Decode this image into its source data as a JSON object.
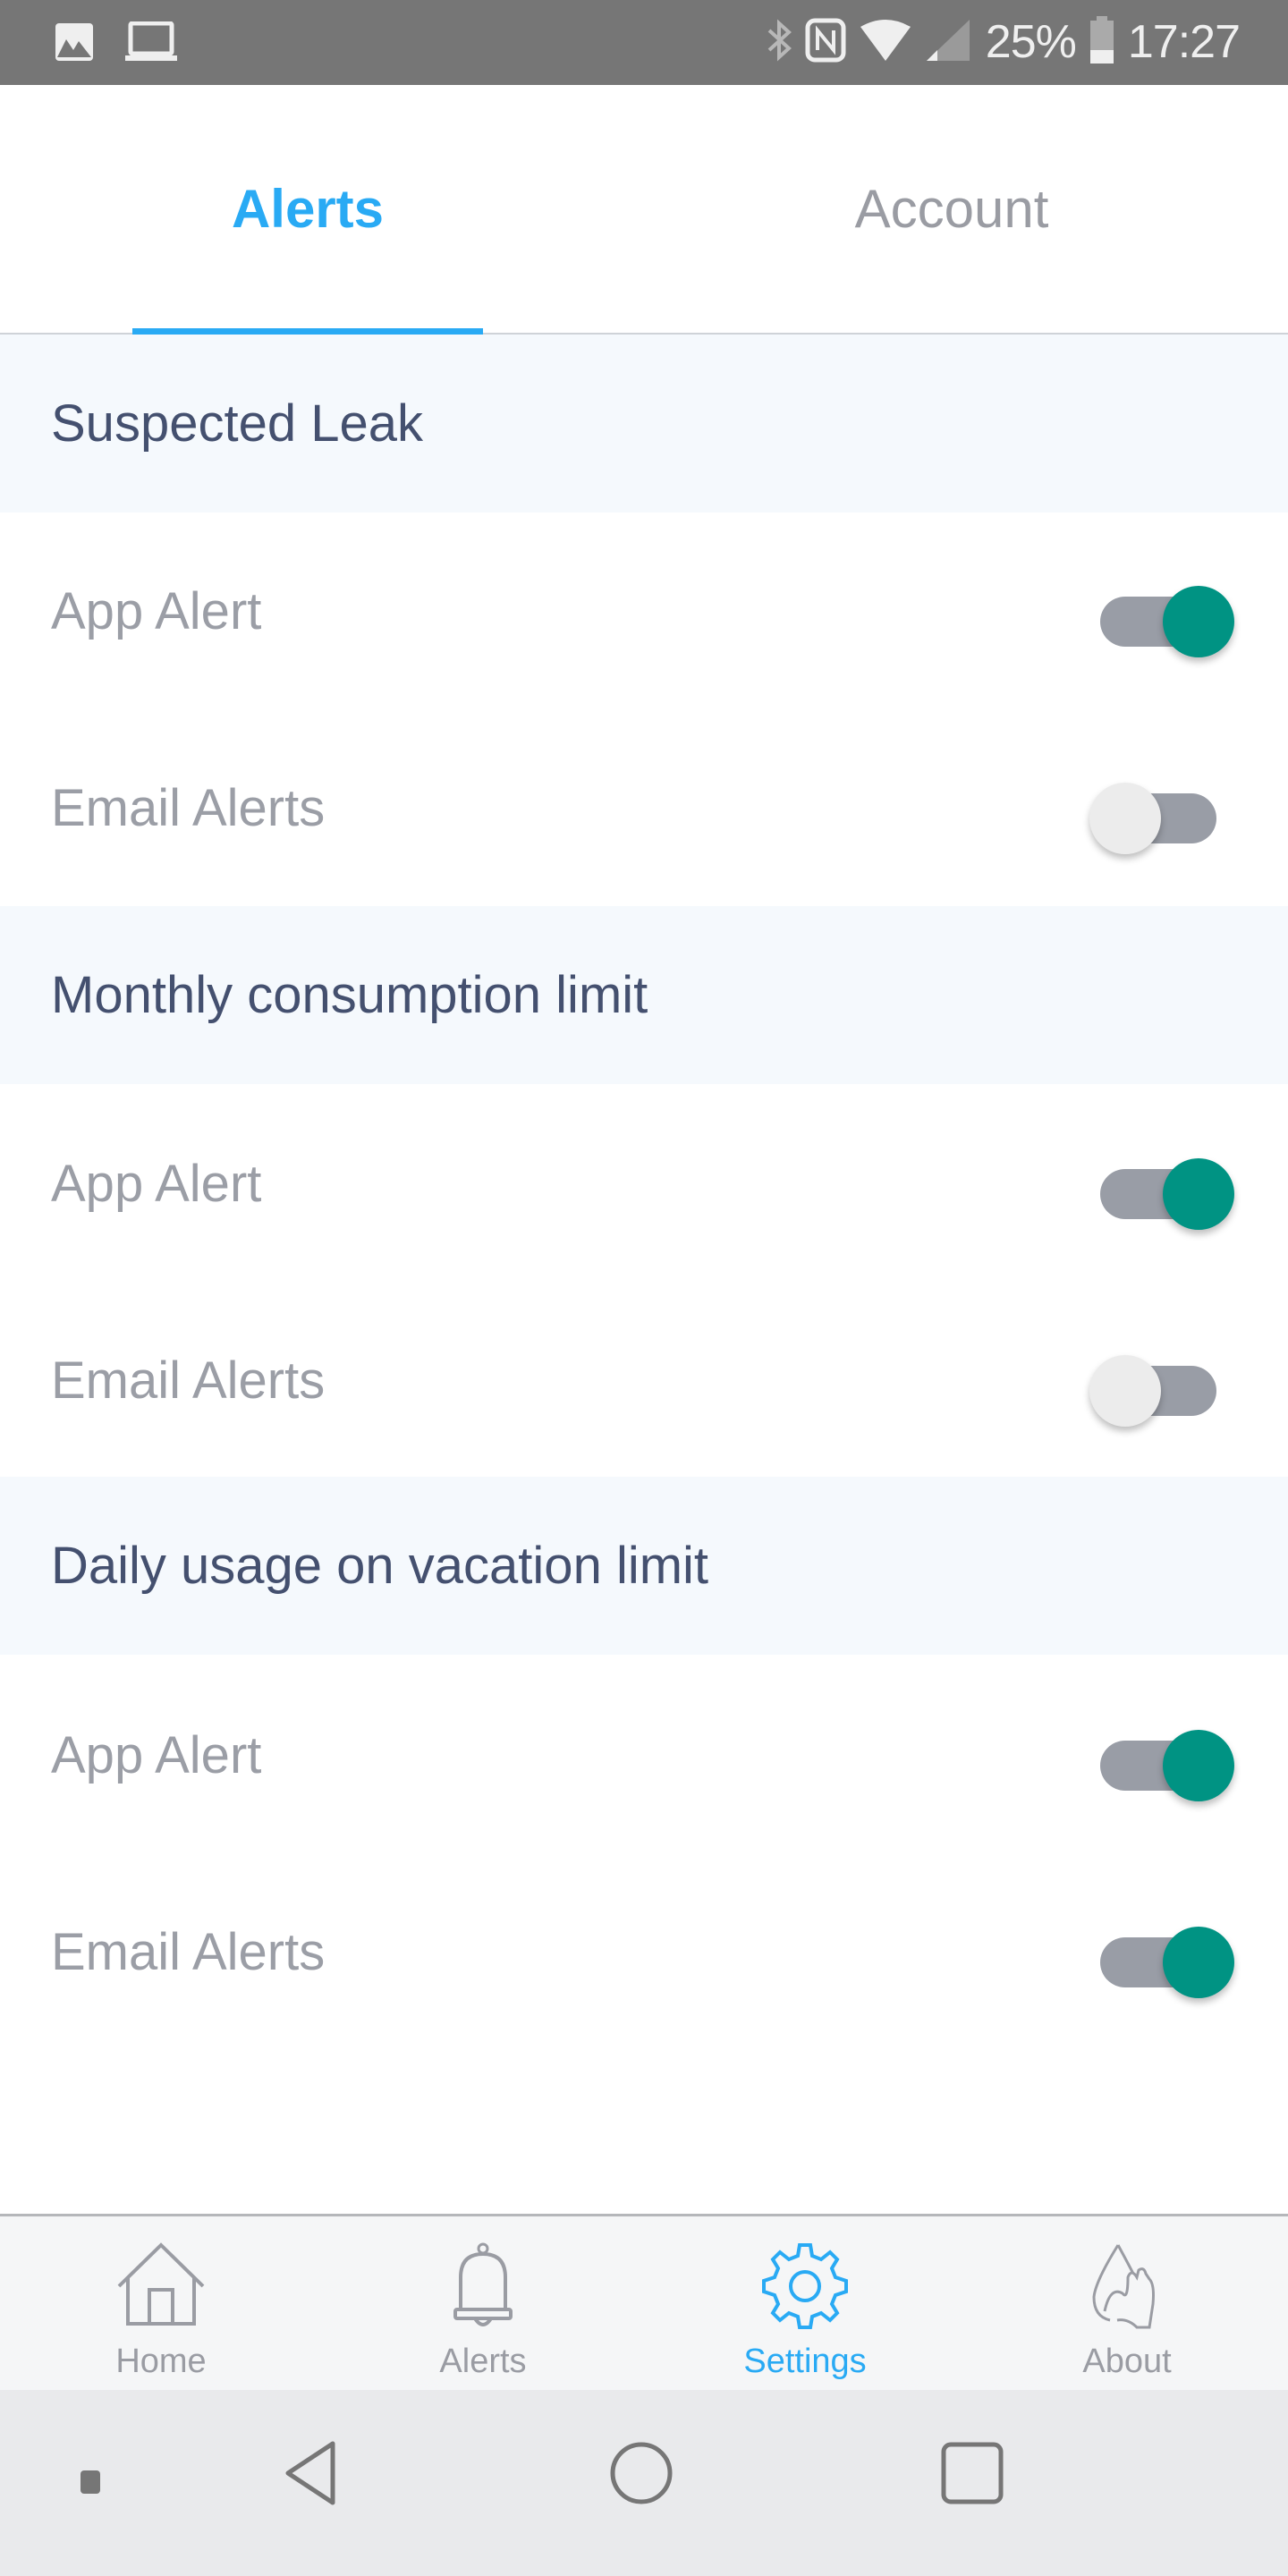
{
  "status_bar": {
    "left_icons": [
      "image-icon",
      "laptop-icon"
    ],
    "right_icons": [
      "bluetooth-icon",
      "nfc-icon",
      "wifi-icon",
      "signal-icon",
      "battery-icon"
    ],
    "battery": "25%",
    "time": "17:27"
  },
  "tabs": [
    {
      "label": "Alerts",
      "active": true
    },
    {
      "label": "Account",
      "active": false
    }
  ],
  "sections": [
    {
      "title": "Suspected Leak",
      "rows": [
        {
          "label": "App Alert",
          "enabled": true
        },
        {
          "label": "Email Alerts",
          "enabled": false
        }
      ]
    },
    {
      "title": "Monthly consumption limit",
      "rows": [
        {
          "label": "App Alert",
          "enabled": true
        },
        {
          "label": "Email Alerts",
          "enabled": false
        }
      ]
    },
    {
      "title": "Daily usage on vacation limit",
      "rows": [
        {
          "label": "App Alert",
          "enabled": true
        },
        {
          "label": "Email Alerts",
          "enabled": true
        }
      ]
    }
  ],
  "bottom_nav": [
    {
      "label": "Home",
      "icon": "home-icon",
      "active": false
    },
    {
      "label": "Alerts",
      "icon": "bell-icon",
      "active": false
    },
    {
      "label": "Settings",
      "icon": "gear-icon",
      "active": true
    },
    {
      "label": "About",
      "icon": "water-hand-icon",
      "active": false
    }
  ],
  "system_nav": [
    "menu-dot",
    "back",
    "home",
    "recents"
  ],
  "colors": {
    "accent": "#29aaf4",
    "toggle_on": "#009383",
    "toggle_track": "#999da6",
    "section_bg": "#f5f9fd",
    "header_text": "#44506f",
    "muted_text": "#9b9ea6"
  }
}
